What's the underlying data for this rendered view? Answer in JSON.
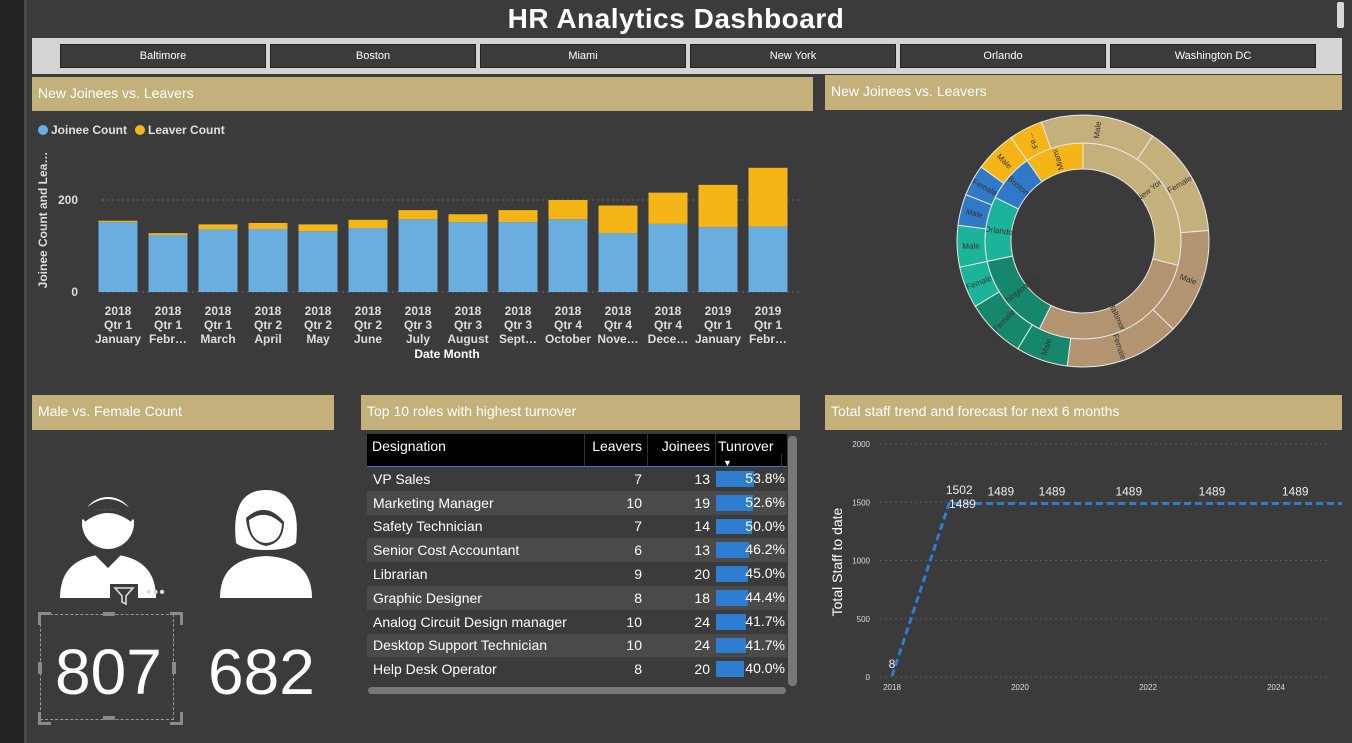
{
  "title": "HR Analytics Dashboard",
  "slicer": [
    "Baltimore",
    "Boston",
    "Miami",
    "New York",
    "Orlando",
    "Washington DC"
  ],
  "panels": {
    "bar_title": "New Joinees vs. Leavers",
    "donut_title": "New Joinees vs. Leavers",
    "gender_title": "Male vs. Female Count",
    "roles_title": "Top 10 roles with highest turnover",
    "trend_title": "Total staff trend and forecast for next 6 months"
  },
  "legend": {
    "joinee": "Joinee Count",
    "leaver": "Leaver Count"
  },
  "colors": {
    "joinee": "#6aaee0",
    "leaver": "#f5b517",
    "header": "#c4b07b",
    "turnover_bar": "#2f7dd1"
  },
  "chart_data": [
    {
      "type": "bar",
      "stacked": true,
      "ylabel": "Joinee Count and Lea…",
      "xlabel": "Date Month",
      "yticks": [
        "0",
        "200"
      ],
      "ylim": [
        0,
        280
      ],
      "categories": [
        [
          "2018",
          "Qtr 1",
          "January"
        ],
        [
          "2018",
          "Qtr 1",
          "Febr…"
        ],
        [
          "2018",
          "Qtr 1",
          "March"
        ],
        [
          "2018",
          "Qtr 2",
          "April"
        ],
        [
          "2018",
          "Qtr 2",
          "May"
        ],
        [
          "2018",
          "Qtr 2",
          "June"
        ],
        [
          "2018",
          "Qtr 3",
          "July"
        ],
        [
          "2018",
          "Qtr 3",
          "August"
        ],
        [
          "2018",
          "Qtr 3",
          "Sept…"
        ],
        [
          "2018",
          "Qtr 4",
          "October"
        ],
        [
          "2018",
          "Qtr 4",
          "Nove…"
        ],
        [
          "2018",
          "Qtr 4",
          "Dece…"
        ],
        [
          "2019",
          "Qtr 1",
          "January"
        ],
        [
          "2019",
          "Qtr 1",
          "Febr…"
        ]
      ],
      "series": [
        {
          "name": "Joinee Count",
          "values": [
            152,
            124,
            136,
            137,
            132,
            139,
            158,
            152,
            152,
            158,
            128,
            148,
            141,
            142
          ]
        },
        {
          "name": "Leaver Count",
          "values": [
            3,
            4,
            11,
            13,
            15,
            18,
            20,
            17,
            26,
            42,
            60,
            68,
            92,
            128
          ]
        }
      ]
    },
    {
      "type": "pie",
      "variant": "sunburst",
      "inner": [
        {
          "label": "Miami",
          "value": 2.9,
          "color": "#f5b517"
        },
        {
          "label": "New York",
          "value": 8.7,
          "color": "#c4b07b"
        },
        {
          "label": "Baltimore",
          "value": 8.5,
          "color": "#b39470"
        },
        {
          "label": "Washington DC",
          "value": 4.3,
          "color": "#17876c"
        },
        {
          "label": "Orlando",
          "value": 3.2,
          "color": "#1bb399"
        },
        {
          "label": "Boston",
          "value": 2.4,
          "color": "#2f79c6"
        }
      ],
      "outer": [
        {
          "label": "Fe...",
          "value": 1.3,
          "color": "#f5b517"
        },
        {
          "label": "Male",
          "value": 4.4,
          "color": "#c4b07b"
        },
        {
          "label": "Female",
          "value": 4.3,
          "color": "#c4b07b"
        },
        {
          "label": "Male",
          "value": 4.1,
          "color": "#b39470"
        },
        {
          "label": "Female",
          "value": 4.4,
          "color": "#b39470"
        },
        {
          "label": "Male",
          "value": 2.0,
          "color": "#17876c"
        },
        {
          "label": "Female",
          "value": 2.3,
          "color": "#17876c"
        },
        {
          "label": "Female",
          "value": 1.6,
          "color": "#1bb399"
        },
        {
          "label": "Male",
          "value": 1.6,
          "color": "#1bb399"
        },
        {
          "label": "Male",
          "value": 1.2,
          "color": "#2f79c6"
        },
        {
          "label": "Female",
          "value": 1.2,
          "color": "#2f79c6"
        },
        {
          "label": "Male",
          "value": 1.6,
          "color": "#f5b517"
        }
      ]
    },
    {
      "type": "line",
      "ylabel": "Total Staff to date",
      "ylim": [
        0,
        2000
      ],
      "yticks": [
        0,
        500,
        1000,
        1500,
        2000
      ],
      "xticks": [
        "2018",
        "2020",
        "2022",
        "2024"
      ],
      "xlim": [
        2018,
        2025.2
      ],
      "points": [
        {
          "x": 2018,
          "y": 8
        },
        {
          "x": 2018.9,
          "y": 1502
        },
        {
          "x": 2019.0,
          "y": 1489
        }
      ],
      "forecast_level": 1489,
      "forecast_end_x": 2025.6,
      "labels": [
        {
          "text": "8",
          "x": 2018,
          "y": 8
        },
        {
          "text": "1502",
          "x": 2019.05,
          "y": 1502
        },
        {
          "text": "1489",
          "x": 2019.1,
          "y": 1380
        },
        {
          "text": "1489",
          "x": 2019.7,
          "y": 1489
        },
        {
          "text": "1489",
          "x": 2020.5,
          "y": 1489
        },
        {
          "text": "1489",
          "x": 2021.7,
          "y": 1489
        },
        {
          "text": "1489",
          "x": 2023.0,
          "y": 1489
        },
        {
          "text": "1489",
          "x": 2024.3,
          "y": 1489
        }
      ]
    }
  ],
  "roles_table": {
    "headers": [
      "Designation",
      "Leavers",
      "Joinees",
      "Tunrover"
    ],
    "rows": [
      {
        "designation": "VP Sales",
        "leavers": "7",
        "joinees": "13",
        "turnover": "53.8%",
        "pct": 53.8
      },
      {
        "designation": "Marketing Manager",
        "leavers": "10",
        "joinees": "19",
        "turnover": "52.6%",
        "pct": 52.6
      },
      {
        "designation": "Safety Technician",
        "leavers": "7",
        "joinees": "14",
        "turnover": "50.0%",
        "pct": 50.0
      },
      {
        "designation": "Senior Cost Accountant",
        "leavers": "6",
        "joinees": "13",
        "turnover": "46.2%",
        "pct": 46.2
      },
      {
        "designation": "Librarian",
        "leavers": "9",
        "joinees": "20",
        "turnover": "45.0%",
        "pct": 45.0
      },
      {
        "designation": "Graphic Designer",
        "leavers": "8",
        "joinees": "18",
        "turnover": "44.4%",
        "pct": 44.4
      },
      {
        "designation": "Analog Circuit Design manager",
        "leavers": "10",
        "joinees": "24",
        "turnover": "41.7%",
        "pct": 41.7
      },
      {
        "designation": "Desktop Support Technician",
        "leavers": "10",
        "joinees": "24",
        "turnover": "41.7%",
        "pct": 41.7
      },
      {
        "designation": "Help Desk Operator",
        "leavers": "8",
        "joinees": "20",
        "turnover": "40.0%",
        "pct": 40.0
      }
    ]
  },
  "gender": {
    "male_count": "807",
    "female_count": "682",
    "male_icon": "male-user-icon",
    "female_icon": "female-user-icon"
  }
}
